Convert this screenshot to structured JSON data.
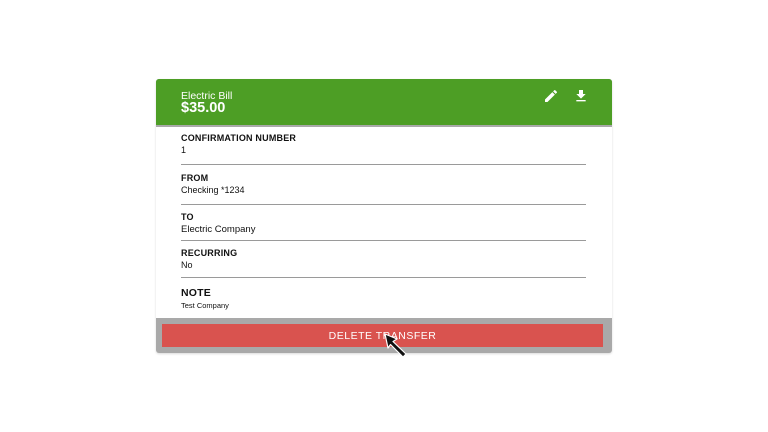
{
  "card": {
    "title": "Electric Bill",
    "amount": "$35.00",
    "header_color": "#4d9e25",
    "actions": [
      {
        "name": "edit",
        "icon": "pencil-icon"
      },
      {
        "name": "download",
        "icon": "download-icon"
      }
    ]
  },
  "details": {
    "confirmation": {
      "label": "CONFIRMATION NUMBER",
      "value": "1"
    },
    "from": {
      "label": "FROM",
      "value": "Checking *1234"
    },
    "to": {
      "label": "TO",
      "value": "Electric Company"
    },
    "recurring": {
      "label": "RECURRING",
      "value": "No"
    },
    "note": {
      "label": "NOTE",
      "value": "Test Company"
    }
  },
  "delete_button": {
    "label": "DELETE TRANSFER",
    "color": "#d9534f"
  }
}
